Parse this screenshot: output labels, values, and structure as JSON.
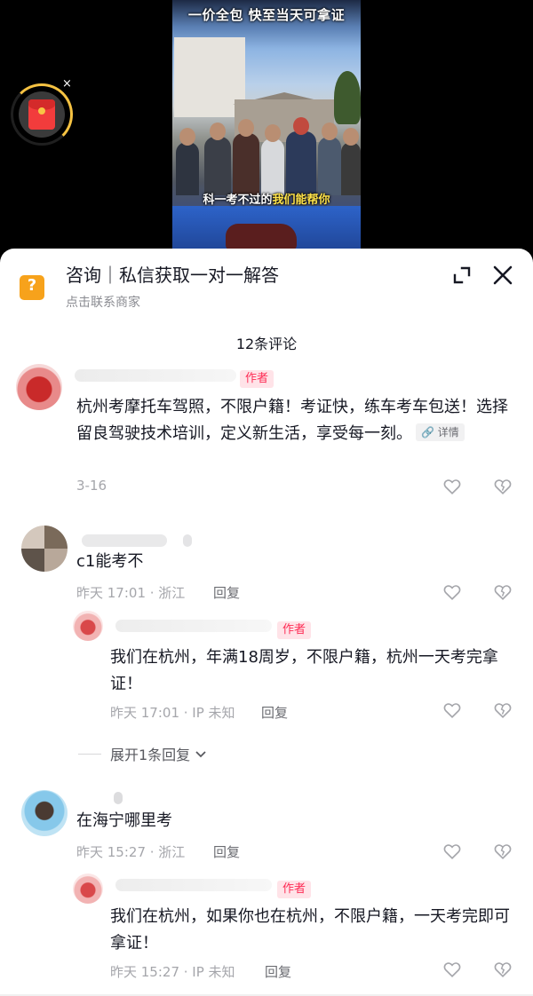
{
  "video": {
    "top_caption": "一价全包  快至当天可拿证",
    "subtitle_pre": "科一考不过的",
    "subtitle_hl": "我们能帮你",
    "close_label": "×"
  },
  "consult": {
    "title": "咨询｜私信获取一对一解答",
    "subtitle": "点击联系商家",
    "icon": "question-icon"
  },
  "comment_count": "12条评论",
  "author_badge": "作者",
  "reply_label": "回复",
  "comments": [
    {
      "text": "杭州考摩托车驾照，不限户籍！考证快，练车考车包送！选择留良驾驶技术培训，定义新生活，享受每一刻。",
      "detail_chip": "🔗 详情",
      "meta": "3-16",
      "is_author": true
    },
    {
      "text": "c1能考不",
      "meta": "昨天 17:01 · 浙江",
      "reply": {
        "text": "我们在杭州，年满18周岁，不限户籍，杭州一天考完拿证！",
        "meta": "昨天 17:01 · IP 未知",
        "is_author": true
      },
      "expand": "展开1条回复"
    },
    {
      "text": "在海宁哪里考",
      "meta": "昨天 15:27 · 浙江",
      "reply": {
        "text": "我们在杭州，如果你也在杭州，不限户籍，一天考完即可拿证！",
        "meta": "昨天 15:27 · IP 未知",
        "is_author": true
      }
    }
  ],
  "colors": {
    "accent_red": "#fe2c55",
    "consult_orange": "#f7a21b",
    "meta_gray": "#a5a6ab"
  }
}
